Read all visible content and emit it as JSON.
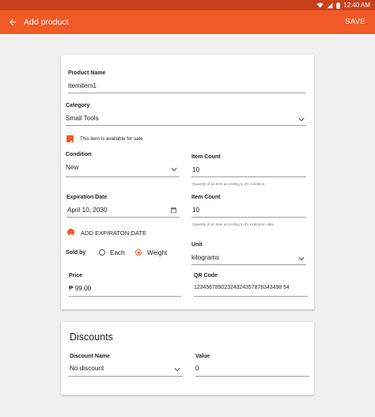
{
  "status_bar": {
    "time": "12:40 AM"
  },
  "app_bar": {
    "title": "Add product",
    "save_label": "SAVE"
  },
  "colors": {
    "primary": "#f05a26",
    "primary_dark": "#c7401b"
  },
  "product_form": {
    "product_name": {
      "label": "Product Name",
      "value": "Itemitem1"
    },
    "category": {
      "label": "Category",
      "value": "Small Tools"
    },
    "available_checkbox": {
      "label": "This item is available for sale",
      "checked": true
    },
    "condition": {
      "label": "Condition",
      "value": "New"
    },
    "item_count_1": {
      "label": "Item Count",
      "value": "10",
      "helper": "Quantity of an item according to it's condition."
    },
    "expiration_date": {
      "label": "Expiration Date",
      "value": "April 10, 2030"
    },
    "item_count_2": {
      "label": "Item Count",
      "value": "10",
      "helper": "Quantity of an item according to it's expiration date."
    },
    "add_expiration": {
      "label": "ADD EXPIRATON DATE"
    },
    "sold_by": {
      "label": "Sold by",
      "options": [
        "Each",
        "Weight"
      ],
      "selected": "Weight"
    },
    "unit": {
      "label": "Unit",
      "value": "kilograms"
    },
    "price": {
      "label": "Price",
      "value": "₱ 99.00"
    },
    "qr_code": {
      "label": "QR Code",
      "value": "12345678902324324357878343498 54"
    }
  },
  "discounts": {
    "title": "Discounts",
    "discount_name": {
      "label": "Discount Name",
      "value": "No discount"
    },
    "value": {
      "label": "Value",
      "value": "0"
    }
  }
}
